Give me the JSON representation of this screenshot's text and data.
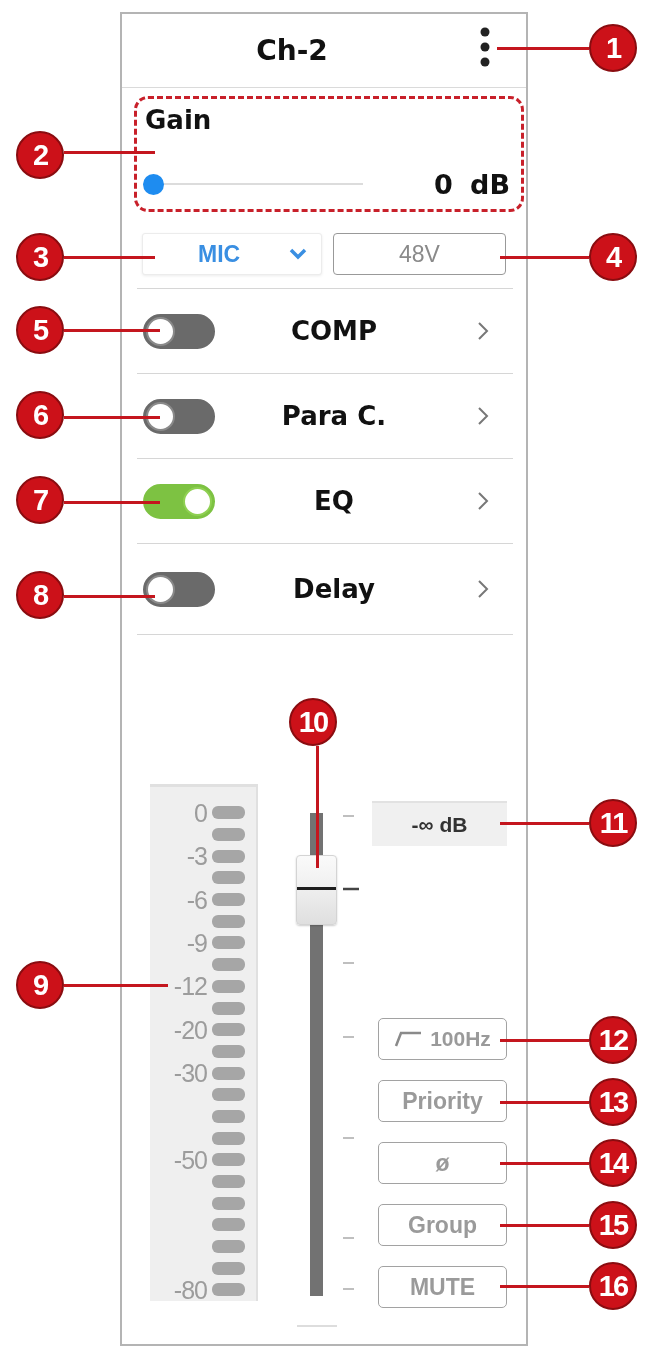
{
  "channel": {
    "title": "Ch-2"
  },
  "gain": {
    "label": "Gain",
    "level": 0,
    "reading": "0 dB"
  },
  "input": {
    "source": "MIC",
    "phantom": "48V"
  },
  "modules": [
    {
      "label": "COMP",
      "on": false
    },
    {
      "label": "Para C.",
      "on": false
    },
    {
      "label": "EQ",
      "on": true
    },
    {
      "label": "Delay",
      "on": false
    }
  ],
  "meter": {
    "level": 0,
    "scale": [
      "0",
      "-3",
      "-6",
      "-9",
      "-12",
      "-20",
      "-30",
      "-50",
      "-80"
    ]
  },
  "fader": {
    "level": 0.84,
    "readout": "-∞ dB"
  },
  "buttons": [
    {
      "kind": "filter",
      "label": "100Hz"
    },
    {
      "kind": "text",
      "label": "Priority"
    },
    {
      "kind": "text",
      "label": "ø"
    },
    {
      "kind": "text",
      "label": "Group"
    },
    {
      "kind": "text",
      "label": "MUTE"
    }
  ],
  "callouts": [
    "1",
    "2",
    "3",
    "4",
    "5",
    "6",
    "7",
    "8",
    "9",
    "10",
    "11",
    "12",
    "13",
    "14",
    "15",
    "16"
  ]
}
